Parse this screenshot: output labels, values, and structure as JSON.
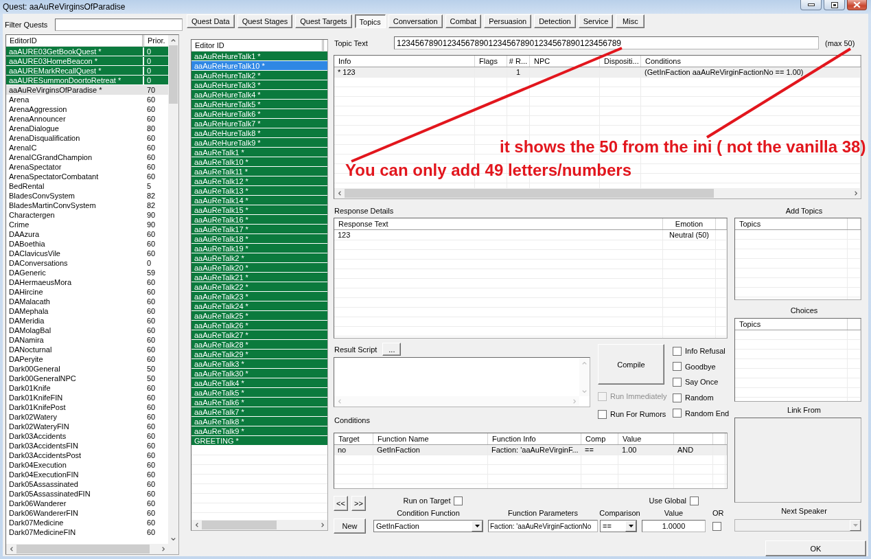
{
  "window": {
    "title": "Quest: aaAuReVirginsOfParadise"
  },
  "quest_filter": {
    "label": "Filter Quests"
  },
  "quest_list": {
    "columns": [
      "EditorID",
      "Prior."
    ],
    "rows": [
      {
        "editor_id": "aaAURE03GetBookQuest *",
        "priority": "0",
        "highlighted": true,
        "selected": false
      },
      {
        "editor_id": "aaAURE03HomeBeacon *",
        "priority": "0",
        "highlighted": true,
        "selected": false
      },
      {
        "editor_id": "aaAUREMarkRecallQuest *",
        "priority": "0",
        "highlighted": true,
        "selected": false
      },
      {
        "editor_id": "aaAURESummonDoortoRetreat *",
        "priority": "0",
        "highlighted": true,
        "selected": false
      },
      {
        "editor_id": "aaAuReVirginsOfParadise *",
        "priority": "70",
        "highlighted": false,
        "selected": true
      },
      {
        "editor_id": "Arena",
        "priority": "60",
        "highlighted": false,
        "selected": false
      },
      {
        "editor_id": "ArenaAggression",
        "priority": "60",
        "highlighted": false,
        "selected": false
      },
      {
        "editor_id": "ArenaAnnouncer",
        "priority": "60",
        "highlighted": false,
        "selected": false
      },
      {
        "editor_id": "ArenaDialogue",
        "priority": "80",
        "highlighted": false,
        "selected": false
      },
      {
        "editor_id": "ArenaDisqualification",
        "priority": "60",
        "highlighted": false,
        "selected": false
      },
      {
        "editor_id": "ArenaIC",
        "priority": "60",
        "highlighted": false,
        "selected": false
      },
      {
        "editor_id": "ArenaICGrandChampion",
        "priority": "60",
        "highlighted": false,
        "selected": false
      },
      {
        "editor_id": "ArenaSpectator",
        "priority": "60",
        "highlighted": false,
        "selected": false
      },
      {
        "editor_id": "ArenaSpectatorCombatant",
        "priority": "60",
        "highlighted": false,
        "selected": false
      },
      {
        "editor_id": "BedRental",
        "priority": "5",
        "highlighted": false,
        "selected": false
      },
      {
        "editor_id": "BladesConvSystem",
        "priority": "82",
        "highlighted": false,
        "selected": false
      },
      {
        "editor_id": "BladesMartinConvSystem",
        "priority": "82",
        "highlighted": false,
        "selected": false
      },
      {
        "editor_id": "Charactergen",
        "priority": "90",
        "highlighted": false,
        "selected": false
      },
      {
        "editor_id": "Crime",
        "priority": "90",
        "highlighted": false,
        "selected": false
      },
      {
        "editor_id": "DAAzura",
        "priority": "60",
        "highlighted": false,
        "selected": false
      },
      {
        "editor_id": "DABoethia",
        "priority": "60",
        "highlighted": false,
        "selected": false
      },
      {
        "editor_id": "DAClavicusVile",
        "priority": "60",
        "highlighted": false,
        "selected": false
      },
      {
        "editor_id": "DAConversations",
        "priority": "0",
        "highlighted": false,
        "selected": false
      },
      {
        "editor_id": "DAGeneric",
        "priority": "59",
        "highlighted": false,
        "selected": false
      },
      {
        "editor_id": "DAHermaeusMora",
        "priority": "60",
        "highlighted": false,
        "selected": false
      },
      {
        "editor_id": "DAHircine",
        "priority": "60",
        "highlighted": false,
        "selected": false
      },
      {
        "editor_id": "DAMalacath",
        "priority": "60",
        "highlighted": false,
        "selected": false
      },
      {
        "editor_id": "DAMephala",
        "priority": "60",
        "highlighted": false,
        "selected": false
      },
      {
        "editor_id": "DAMeridia",
        "priority": "60",
        "highlighted": false,
        "selected": false
      },
      {
        "editor_id": "DAMolagBal",
        "priority": "60",
        "highlighted": false,
        "selected": false
      },
      {
        "editor_id": "DANamira",
        "priority": "60",
        "highlighted": false,
        "selected": false
      },
      {
        "editor_id": "DANocturnal",
        "priority": "60",
        "highlighted": false,
        "selected": false
      },
      {
        "editor_id": "DAPeryite",
        "priority": "60",
        "highlighted": false,
        "selected": false
      },
      {
        "editor_id": "Dark00General",
        "priority": "50",
        "highlighted": false,
        "selected": false
      },
      {
        "editor_id": "Dark00GeneralNPC",
        "priority": "50",
        "highlighted": false,
        "selected": false
      },
      {
        "editor_id": "Dark01Knife",
        "priority": "60",
        "highlighted": false,
        "selected": false
      },
      {
        "editor_id": "Dark01KnifeFIN",
        "priority": "60",
        "highlighted": false,
        "selected": false
      },
      {
        "editor_id": "Dark01KnifePost",
        "priority": "60",
        "highlighted": false,
        "selected": false
      },
      {
        "editor_id": "Dark02Watery",
        "priority": "60",
        "highlighted": false,
        "selected": false
      },
      {
        "editor_id": "Dark02WateryFIN",
        "priority": "60",
        "highlighted": false,
        "selected": false
      },
      {
        "editor_id": "Dark03Accidents",
        "priority": "60",
        "highlighted": false,
        "selected": false
      },
      {
        "editor_id": "Dark03AccidentsFIN",
        "priority": "60",
        "highlighted": false,
        "selected": false
      },
      {
        "editor_id": "Dark03AccidentsPost",
        "priority": "60",
        "highlighted": false,
        "selected": false
      },
      {
        "editor_id": "Dark04Execution",
        "priority": "60",
        "highlighted": false,
        "selected": false
      },
      {
        "editor_id": "Dark04ExecutionFIN",
        "priority": "60",
        "highlighted": false,
        "selected": false
      },
      {
        "editor_id": "Dark05Assassinated",
        "priority": "60",
        "highlighted": false,
        "selected": false
      },
      {
        "editor_id": "Dark05AssassinatedFIN",
        "priority": "60",
        "highlighted": false,
        "selected": false
      },
      {
        "editor_id": "Dark06Wanderer",
        "priority": "60",
        "highlighted": false,
        "selected": false
      },
      {
        "editor_id": "Dark06WandererFIN",
        "priority": "60",
        "highlighted": false,
        "selected": false
      },
      {
        "editor_id": "Dark07Medicine",
        "priority": "60",
        "highlighted": false,
        "selected": false
      },
      {
        "editor_id": "Dark07MedicineFIN",
        "priority": "60",
        "highlighted": false,
        "selected": false
      }
    ]
  },
  "tabs": [
    {
      "label": "Quest Data",
      "selected": false
    },
    {
      "label": "Quest Stages",
      "selected": false
    },
    {
      "label": "Quest Targets",
      "selected": false
    },
    {
      "label": "Topics",
      "selected": true
    },
    {
      "label": "Conversation",
      "selected": false
    },
    {
      "label": "Combat",
      "selected": false
    },
    {
      "label": "Persuasion",
      "selected": false
    },
    {
      "label": "Detection",
      "selected": false
    },
    {
      "label": "Service",
      "selected": false
    },
    {
      "label": "Misc",
      "selected": false
    }
  ],
  "topic_list": {
    "columns": [
      "Editor ID"
    ],
    "rows": [
      {
        "name": "aaAuReHureTalk1 *",
        "highlighted": true,
        "selected": false
      },
      {
        "name": "aaAuReHureTalk10 *",
        "highlighted": true,
        "selected": true
      },
      {
        "name": "aaAuReHureTalk2 *",
        "highlighted": true,
        "selected": false
      },
      {
        "name": "aaAuReHureTalk3 *",
        "highlighted": true,
        "selected": false
      },
      {
        "name": "aaAuReHureTalk4 *",
        "highlighted": true,
        "selected": false
      },
      {
        "name": "aaAuReHureTalk5 *",
        "highlighted": true,
        "selected": false
      },
      {
        "name": "aaAuReHureTalk6 *",
        "highlighted": true,
        "selected": false
      },
      {
        "name": "aaAuReHureTalk7 *",
        "highlighted": true,
        "selected": false
      },
      {
        "name": "aaAuReHureTalk8 *",
        "highlighted": true,
        "selected": false
      },
      {
        "name": "aaAuReHureTalk9 *",
        "highlighted": true,
        "selected": false
      },
      {
        "name": "aaAuReTalk1 *",
        "highlighted": true,
        "selected": false
      },
      {
        "name": "aaAuReTalk10 *",
        "highlighted": true,
        "selected": false
      },
      {
        "name": "aaAuReTalk11 *",
        "highlighted": true,
        "selected": false
      },
      {
        "name": "aaAuReTalk12 *",
        "highlighted": true,
        "selected": false
      },
      {
        "name": "aaAuReTalk13 *",
        "highlighted": true,
        "selected": false
      },
      {
        "name": "aaAuReTalk14 *",
        "highlighted": true,
        "selected": false
      },
      {
        "name": "aaAuReTalk15 *",
        "highlighted": true,
        "selected": false
      },
      {
        "name": "aaAuReTalk16 *",
        "highlighted": true,
        "selected": false
      },
      {
        "name": "aaAuReTalk17 *",
        "highlighted": true,
        "selected": false
      },
      {
        "name": "aaAuReTalk18 *",
        "highlighted": true,
        "selected": false
      },
      {
        "name": "aaAuReTalk19 *",
        "highlighted": true,
        "selected": false
      },
      {
        "name": "aaAuReTalk2 *",
        "highlighted": true,
        "selected": false
      },
      {
        "name": "aaAuReTalk20 *",
        "highlighted": true,
        "selected": false
      },
      {
        "name": "aaAuReTalk21 *",
        "highlighted": true,
        "selected": false
      },
      {
        "name": "aaAuReTalk22 *",
        "highlighted": true,
        "selected": false
      },
      {
        "name": "aaAuReTalk23 *",
        "highlighted": true,
        "selected": false
      },
      {
        "name": "aaAuReTalk24 *",
        "highlighted": true,
        "selected": false
      },
      {
        "name": "aaAuReTalk25 *",
        "highlighted": true,
        "selected": false
      },
      {
        "name": "aaAuReTalk26 *",
        "highlighted": true,
        "selected": false
      },
      {
        "name": "aaAuReTalk27 *",
        "highlighted": true,
        "selected": false
      },
      {
        "name": "aaAuReTalk28 *",
        "highlighted": true,
        "selected": false
      },
      {
        "name": "aaAuReTalk29 *",
        "highlighted": true,
        "selected": false
      },
      {
        "name": "aaAuReTalk3 *",
        "highlighted": true,
        "selected": false
      },
      {
        "name": "aaAuReTalk30 *",
        "highlighted": true,
        "selected": false
      },
      {
        "name": "aaAuReTalk4 *",
        "highlighted": true,
        "selected": false
      },
      {
        "name": "aaAuReTalk5 *",
        "highlighted": true,
        "selected": false
      },
      {
        "name": "aaAuReTalk6 *",
        "highlighted": true,
        "selected": false
      },
      {
        "name": "aaAuReTalk7 *",
        "highlighted": true,
        "selected": false
      },
      {
        "name": "aaAuReTalk8 *",
        "highlighted": true,
        "selected": false
      },
      {
        "name": "aaAuReTalk9 *",
        "highlighted": true,
        "selected": false
      },
      {
        "name": "GREETING *",
        "highlighted": true,
        "selected": false
      }
    ]
  },
  "topic_text": {
    "label": "Topic Text",
    "value": "1234567890123456789012345678901234567890123456789",
    "limit": "(max 50)"
  },
  "info_table": {
    "columns": [
      "Info",
      "Flags",
      "# R...",
      "NPC",
      "Dispositi...",
      "Conditions"
    ],
    "rows": [
      {
        "cells": [
          "* 123",
          null,
          "1",
          null,
          null,
          "(GetInFaction aaAuReVirginFactionNo == 1.00)"
        ],
        "selected": true
      }
    ]
  },
  "annotations": [
    {
      "text": "it shows the 50 from the ini ( not the vanilla 38)"
    },
    {
      "text": "You can only add 49 letters/numbers"
    }
  ],
  "response_details": {
    "label": "Response Details",
    "columns": [
      "Response Text",
      "Emotion"
    ],
    "rows": [
      {
        "cells": [
          "123",
          "Neutral (50)"
        ],
        "selected": false
      }
    ]
  },
  "result_script": {
    "label": "Result Script",
    "edit_button": "..."
  },
  "compile_button": "Compile",
  "script_flags": [
    {
      "label": "Run Immediately",
      "checked": false,
      "disabled": true
    },
    {
      "label": "Run For Rumors",
      "checked": false,
      "disabled": false
    }
  ],
  "response_flags": [
    {
      "label": "Info Refusal",
      "checked": false
    },
    {
      "label": "Goodbye",
      "checked": false
    },
    {
      "label": "Say Once",
      "checked": false
    },
    {
      "label": "Random",
      "checked": false
    },
    {
      "label": "Random End",
      "checked": false
    }
  ],
  "conditions": {
    "label": "Conditions",
    "columns": [
      "Target",
      "Function Name",
      "Function Info",
      "Comp",
      "Value"
    ],
    "rows": [
      {
        "cells": [
          "no",
          "GetInFaction",
          "Faction: 'aaAuReVirginF...",
          "==",
          "1.00",
          "AND"
        ],
        "selected": true
      }
    ]
  },
  "condition_editor": {
    "prev_button": "<<",
    "next_button": ">>",
    "new_button": "New",
    "run_on_target": {
      "label": "Run on Target",
      "checked": false
    },
    "use_global": {
      "label": "Use Global",
      "checked": false
    },
    "condition_function": {
      "label": "Condition Function",
      "value": "GetInFaction"
    },
    "function_parameters": {
      "label": "Function Parameters",
      "value": "Faction: 'aaAuReVirginFactionNo"
    },
    "comparison": {
      "label": "Comparison",
      "value": "=="
    },
    "value": {
      "label": "Value",
      "value": "1.0000"
    },
    "or": {
      "label": "OR",
      "checked": false
    }
  },
  "add_topics": {
    "title": "Add Topics",
    "columns": [
      "Topics"
    ]
  },
  "choices": {
    "title": "Choices",
    "columns": [
      "Topics"
    ]
  },
  "link_from": {
    "title": "Link From"
  },
  "next_speaker": {
    "label": "Next Speaker",
    "disabled": true
  },
  "ok_button": "OK"
}
